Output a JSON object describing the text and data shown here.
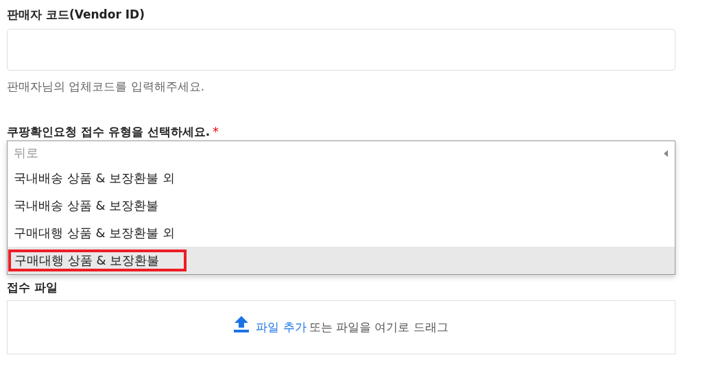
{
  "vendor_field": {
    "label": "판매자 코드(Vendor ID)",
    "help": "판매자님의 업체코드를 입력해주세요."
  },
  "type_field": {
    "label": "쿠팡확인요청 접수 유형을 선택하세요.",
    "required_mark": "*",
    "options": [
      {
        "kind": "back",
        "label": "뒤로",
        "selected": false
      },
      {
        "kind": "option",
        "label": "국내배송 상품 & 보장환불 외",
        "selected": false
      },
      {
        "kind": "option",
        "label": "국내배송 상품 & 보장환불",
        "selected": false
      },
      {
        "kind": "option",
        "label": "구매대행 상품 & 보장환불 외",
        "selected": false
      },
      {
        "kind": "option",
        "label": "구매대행 상품 & 보장환불",
        "selected": true
      }
    ]
  },
  "file_field": {
    "label": "접수 파일",
    "add_link": "파일 추가",
    "drop_text": "또는 파일을 여기로 드래그"
  }
}
